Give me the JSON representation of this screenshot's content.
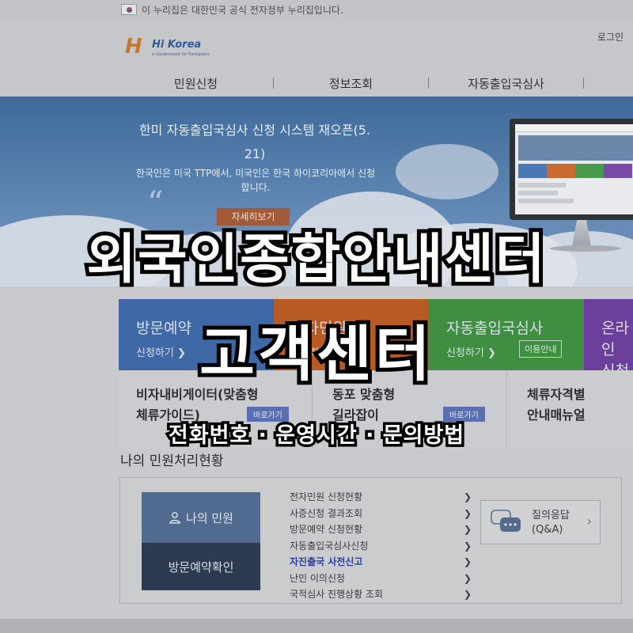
{
  "gov_notice": "이 누리집은 대한민국 공식 전자정부 누리집입니다.",
  "logo": {
    "mark": "H",
    "word": "Hi Korea",
    "sub": "e-Government for Foreigners"
  },
  "header": {
    "login": "로그인"
  },
  "nav": [
    "민원신청",
    "정보조회",
    "자동출입국심사"
  ],
  "banner": {
    "title": "한미 자동출입국심사 신청 시스템 재오픈(5. 21)",
    "subtitle": "한국인은 미국 TTP에서, 미국인은 한국 하이코리아에서 신청합니다.",
    "more": "자세히보기"
  },
  "tiles": [
    {
      "title": "방문예약",
      "link": "신청하기 ❯",
      "color": "#3f68a6"
    },
    {
      "title": "전자민원",
      "link": "신청하기 ❯",
      "color": "#b85a24"
    },
    {
      "title": "자동출입국심사",
      "link": "신청하기 ❯",
      "guide": "이용안내",
      "color": "#3f8f43"
    },
    {
      "title": "온라인",
      "link": "신청",
      "color": "#6b3f9b"
    }
  ],
  "guides": [
    {
      "text": "비자내비게이터(맞춤형 체류가이드)",
      "line1": "비자내비게이터(맞춤형",
      "line2": "체류가이드)",
      "button": "바로가기"
    },
    {
      "text": "동포 맞춤형 길라잡이",
      "line1": "동포 맞춤형",
      "line2": "길라잡이",
      "button": "바로가기"
    },
    {
      "text": "체류자격별 안내매뉴얼",
      "line1": "체류자격별",
      "line2": "안내매뉴얼"
    }
  ],
  "status": {
    "title": "나의 민원처리현황",
    "my_civil": "나의 민원",
    "visit_confirm": "방문예약확인",
    "menu": [
      {
        "label": "전자민원 신청현황",
        "active": false
      },
      {
        "label": "사증신청 결과조회",
        "active": false
      },
      {
        "label": "방문예약 신청현황",
        "active": false
      },
      {
        "label": "자동출입국심사신청",
        "active": false
      },
      {
        "label": "자진출국 사전신고",
        "active": true
      },
      {
        "label": "난민 이의신청",
        "active": false
      },
      {
        "label": "국적심사 진행상황 조회",
        "active": false
      }
    ],
    "qa": {
      "line1": "질의응답",
      "line2": "(Q&A)"
    }
  },
  "overlay": {
    "line1": "외국인종합안내센터",
    "line2": "고객센터",
    "line3": "전화번호 · 운영시간 · 문의방법"
  },
  "colors": {
    "overlay_text": "#ffffff",
    "overlay_stroke": "#000000",
    "active_link": "#2a3ca8"
  }
}
